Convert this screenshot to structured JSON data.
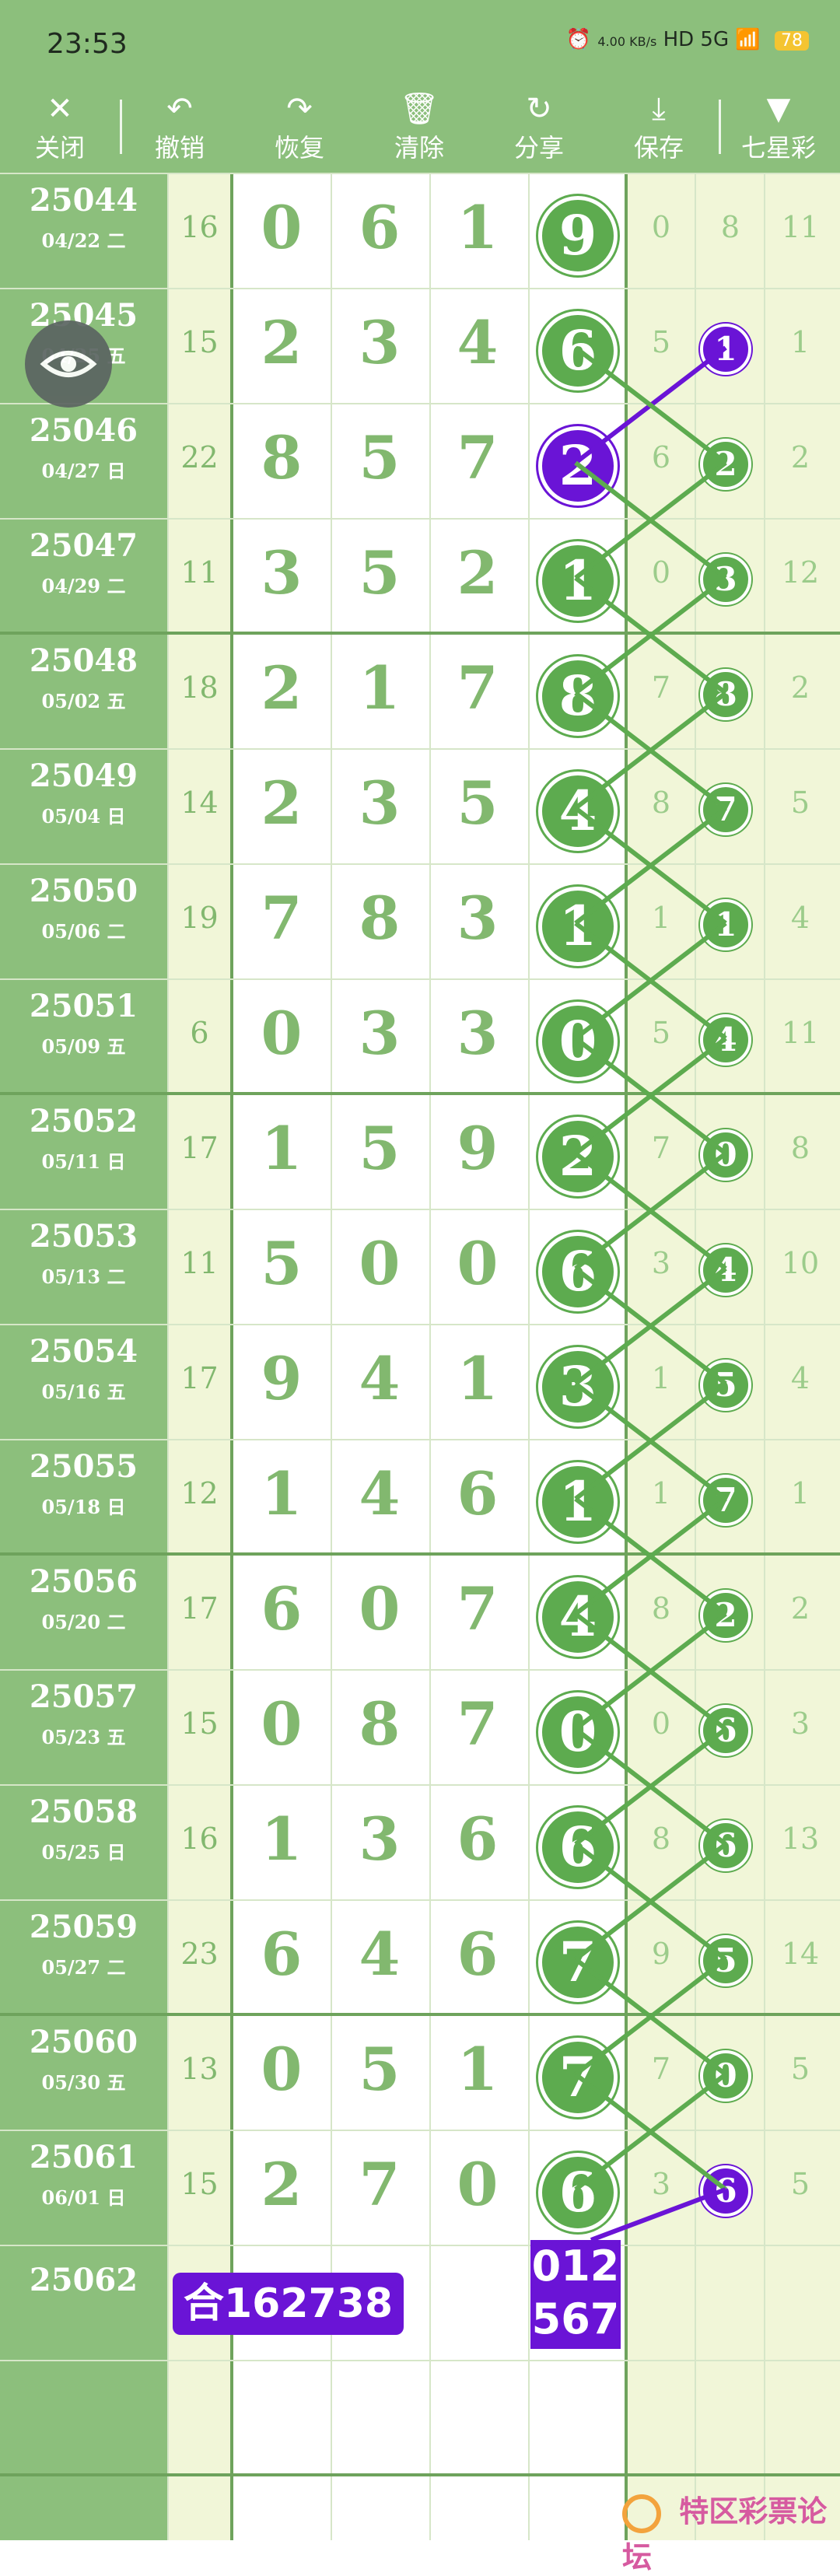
{
  "status": {
    "time": "23:53",
    "netspeed": "4.00 KB/s",
    "icons": "HD 5G",
    "battery": "78"
  },
  "toolbar": [
    {
      "label": "关闭",
      "icon": "close-icon",
      "glyph": "✕"
    },
    {
      "label": "撤销",
      "icon": "undo-icon",
      "glyph": "↶"
    },
    {
      "label": "恢复",
      "icon": "redo-icon",
      "glyph": "↷"
    },
    {
      "label": "清除",
      "icon": "trash-icon",
      "glyph": "🗑"
    },
    {
      "label": "分享",
      "icon": "share-icon",
      "glyph": "↻"
    },
    {
      "label": "保存",
      "icon": "download-icon",
      "glyph": "⤓"
    },
    {
      "label": "七星彩",
      "icon": "dropdown-triangle-icon",
      "glyph": "▼"
    }
  ],
  "rows": [
    {
      "period": "25044",
      "date": "04/22 二",
      "sum": "16",
      "digits": [
        "0",
        "6",
        "1",
        "9"
      ],
      "cols": [
        "0",
        "8",
        "11"
      ],
      "hot": false,
      "ball": null
    },
    {
      "period": "25045",
      "date": "04/25 五",
      "sum": "15",
      "digits": [
        "2",
        "3",
        "4",
        "6"
      ],
      "cols": [
        "5",
        "",
        "1"
      ],
      "hot": false,
      "ball": "1",
      "ballhot": true
    },
    {
      "period": "25046",
      "date": "04/27 日",
      "sum": "22",
      "digits": [
        "8",
        "5",
        "7",
        "2"
      ],
      "cols": [
        "6",
        "",
        "2"
      ],
      "hot": true,
      "ball": "2"
    },
    {
      "period": "25047",
      "date": "04/29 二",
      "sum": "11",
      "digits": [
        "3",
        "5",
        "2",
        "1"
      ],
      "cols": [
        "0",
        "",
        "12"
      ],
      "hot": false,
      "ball": "3"
    },
    {
      "period": "25048",
      "date": "05/02 五",
      "sum": "18",
      "digits": [
        "2",
        "1",
        "7",
        "8"
      ],
      "cols": [
        "7",
        "",
        "2"
      ],
      "hot": false,
      "ball": "8"
    },
    {
      "period": "25049",
      "date": "05/04 日",
      "sum": "14",
      "digits": [
        "2",
        "3",
        "5",
        "4"
      ],
      "cols": [
        "8",
        "",
        "5"
      ],
      "hot": false,
      "ball": "7"
    },
    {
      "period": "25050",
      "date": "05/06 二",
      "sum": "19",
      "digits": [
        "7",
        "8",
        "3",
        "1"
      ],
      "cols": [
        "1",
        "",
        "4"
      ],
      "hot": false,
      "ball": "1"
    },
    {
      "period": "25051",
      "date": "05/09 五",
      "sum": "6",
      "digits": [
        "0",
        "3",
        "3",
        "0"
      ],
      "cols": [
        "5",
        "",
        "11"
      ],
      "hot": false,
      "ball": "4"
    },
    {
      "period": "25052",
      "date": "05/11 日",
      "sum": "17",
      "digits": [
        "1",
        "5",
        "9",
        "2"
      ],
      "cols": [
        "7",
        "",
        "8"
      ],
      "hot": false,
      "ball": "0"
    },
    {
      "period": "25053",
      "date": "05/13 二",
      "sum": "11",
      "digits": [
        "5",
        "0",
        "0",
        "6"
      ],
      "cols": [
        "3",
        "",
        "10"
      ],
      "hot": false,
      "ball": "4"
    },
    {
      "period": "25054",
      "date": "05/16 五",
      "sum": "17",
      "digits": [
        "9",
        "4",
        "1",
        "3"
      ],
      "cols": [
        "1",
        "",
        "4"
      ],
      "hot": false,
      "ball": "5"
    },
    {
      "period": "25055",
      "date": "05/18 日",
      "sum": "12",
      "digits": [
        "1",
        "4",
        "6",
        "1"
      ],
      "cols": [
        "1",
        "",
        "1"
      ],
      "hot": false,
      "ball": "7"
    },
    {
      "period": "25056",
      "date": "05/20 二",
      "sum": "17",
      "digits": [
        "6",
        "0",
        "7",
        "4"
      ],
      "cols": [
        "8",
        "",
        "2"
      ],
      "hot": false,
      "ball": "2"
    },
    {
      "period": "25057",
      "date": "05/23 五",
      "sum": "15",
      "digits": [
        "0",
        "8",
        "7",
        "0"
      ],
      "cols": [
        "0",
        "",
        "3"
      ],
      "hot": false,
      "ball": "6"
    },
    {
      "period": "25058",
      "date": "05/25 日",
      "sum": "16",
      "digits": [
        "1",
        "3",
        "6",
        "6"
      ],
      "cols": [
        "8",
        "",
        "13"
      ],
      "hot": false,
      "ball": "6"
    },
    {
      "period": "25059",
      "date": "05/27 二",
      "sum": "23",
      "digits": [
        "6",
        "4",
        "6",
        "7"
      ],
      "cols": [
        "9",
        "",
        "14"
      ],
      "hot": false,
      "ball": "5"
    },
    {
      "period": "25060",
      "date": "05/30 五",
      "sum": "13",
      "digits": [
        "0",
        "5",
        "1",
        "7"
      ],
      "cols": [
        "7",
        "",
        "5"
      ],
      "hot": false,
      "ball": "0"
    },
    {
      "period": "25061",
      "date": "06/01 日",
      "sum": "15",
      "digits": [
        "2",
        "7",
        "0",
        "6"
      ],
      "cols": [
        "3",
        "",
        "5"
      ],
      "hot": false,
      "ball": "6",
      "ballhot": true
    }
  ],
  "next": {
    "period": "25062",
    "sum_tag": "合162738",
    "pick_tag_line1": "012",
    "pick_tag_line2": "567"
  },
  "logo": {
    "text": "特区彩票论坛"
  },
  "colors": {
    "green": "#8cbf7c",
    "ball_green": "#5dab4f",
    "purple": "#6a14d6"
  }
}
